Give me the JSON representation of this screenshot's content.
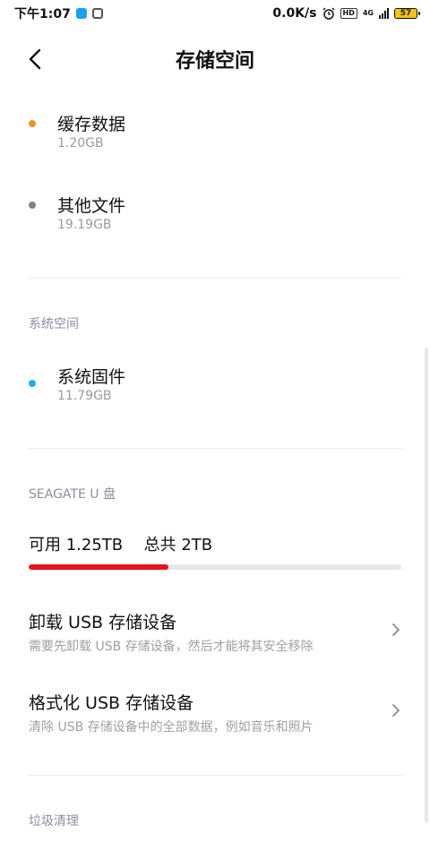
{
  "status": {
    "time": "下午1:07",
    "speed": "0.0K/s",
    "network": "4G",
    "battery": "57"
  },
  "header": {
    "title": "存储空间"
  },
  "storage_items": [
    {
      "label": "缓存数据",
      "size": "1.20GB",
      "color": "#f0902a"
    },
    {
      "label": "其他文件",
      "size": "19.19GB",
      "color": "#7a8190"
    }
  ],
  "system": {
    "header": "系统空间",
    "item": {
      "label": "系统固件",
      "size": "11.79GB",
      "color": "#1aaef0"
    }
  },
  "usb": {
    "header": "SEAGATE U 盘",
    "available_label": "可用 1.25TB",
    "total_label": "总共 2TB",
    "used_fraction": 0.375,
    "used_color": "#e8121e",
    "actions": [
      {
        "title": "卸载 USB 存储设备",
        "subtitle": "需要先卸载 USB 存储设备，然后才能将其安全移除"
      },
      {
        "title": "格式化 USB 存储设备",
        "subtitle": "清除 USB 存储设备中的全部数据，例如音乐和照片"
      }
    ]
  },
  "junk": {
    "header": "垃圾清理"
  }
}
